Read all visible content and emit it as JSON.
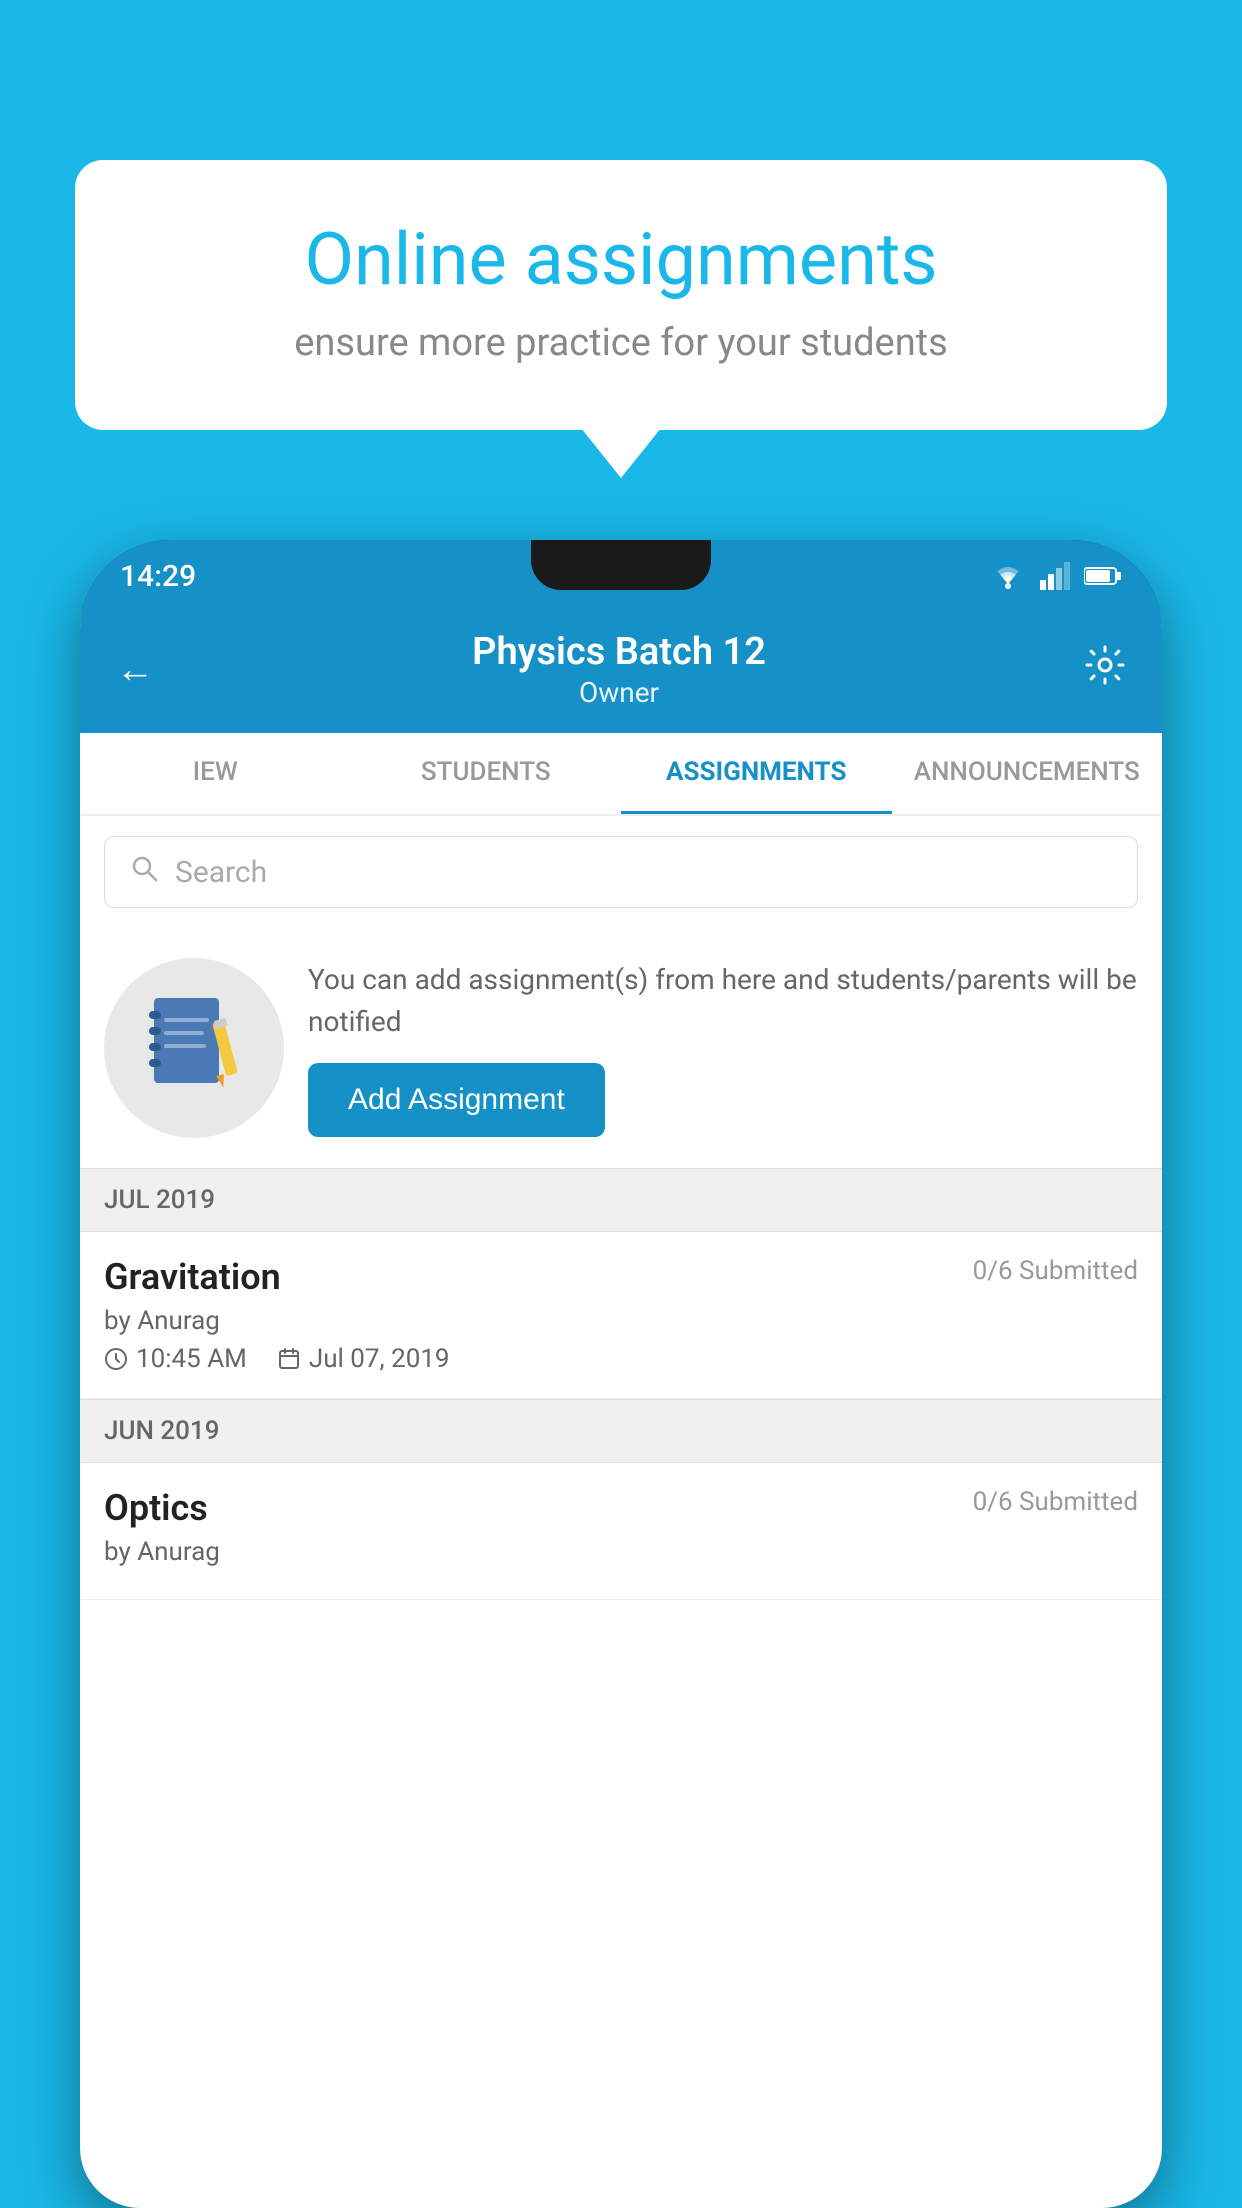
{
  "background_color": "#1ab8e8",
  "speech_bubble": {
    "title": "Online assignments",
    "subtitle": "ensure more practice for your students"
  },
  "phone": {
    "status_bar": {
      "time": "14:29"
    },
    "header": {
      "title": "Physics Batch 12",
      "subtitle": "Owner"
    },
    "tabs": [
      {
        "label": "IEW",
        "active": false
      },
      {
        "label": "STUDENTS",
        "active": false
      },
      {
        "label": "ASSIGNMENTS",
        "active": true
      },
      {
        "label": "ANNOUNCEMENTS",
        "active": false
      }
    ],
    "search": {
      "placeholder": "Search"
    },
    "promo": {
      "text": "You can add assignment(s) from here and students/parents will be notified",
      "button_label": "Add Assignment"
    },
    "sections": [
      {
        "label": "JUL 2019",
        "assignments": [
          {
            "name": "Gravitation",
            "submitted": "0/6 Submitted",
            "by": "by Anurag",
            "time": "10:45 AM",
            "date": "Jul 07, 2019"
          }
        ]
      },
      {
        "label": "JUN 2019",
        "assignments": [
          {
            "name": "Optics",
            "submitted": "0/6 Submitted",
            "by": "by Anurag",
            "time": "",
            "date": ""
          }
        ]
      }
    ]
  }
}
